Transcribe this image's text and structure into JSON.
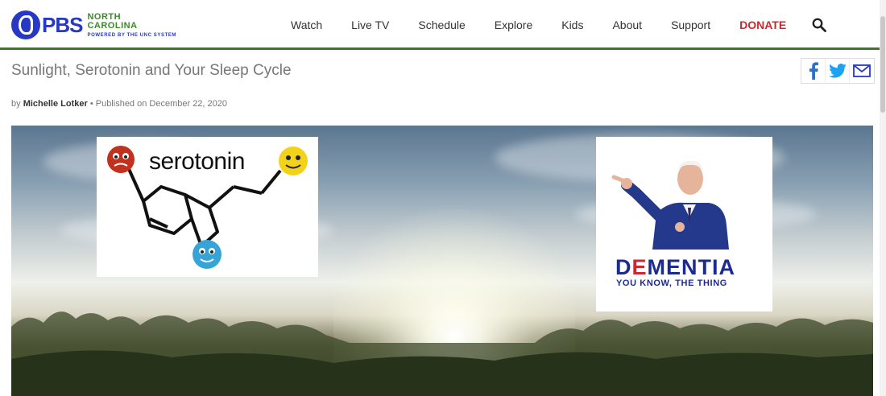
{
  "brand": {
    "logo_text": "PBS",
    "region": "NORTH CAROLINA",
    "tagline": "POWERED BY THE UNC SYSTEM",
    "accent": "#2638c4",
    "green": "#3a8a2a"
  },
  "nav": {
    "items": [
      {
        "label": "Watch"
      },
      {
        "label": "Live TV"
      },
      {
        "label": "Schedule"
      },
      {
        "label": "Explore"
      },
      {
        "label": "Kids"
      },
      {
        "label": "About"
      },
      {
        "label": "Support"
      }
    ],
    "donate": "DONATE",
    "donate_color": "#d0262d",
    "search_icon": "search-icon"
  },
  "article": {
    "title": "Sunlight, Serotonin and Your Sleep Cycle",
    "by": "by",
    "author": "Michelle Lotker",
    "published": "• Published on December 22, 2020"
  },
  "share": {
    "icons": [
      "facebook-icon",
      "twitter-icon",
      "email-icon"
    ]
  },
  "overlay_serotonin": {
    "word": "serotonin"
  },
  "overlay_dementia": {
    "word_part1": "D",
    "word_part2": "E",
    "word_part3": "MENTIA",
    "subtitle": "YOU KNOW, THE THING"
  }
}
